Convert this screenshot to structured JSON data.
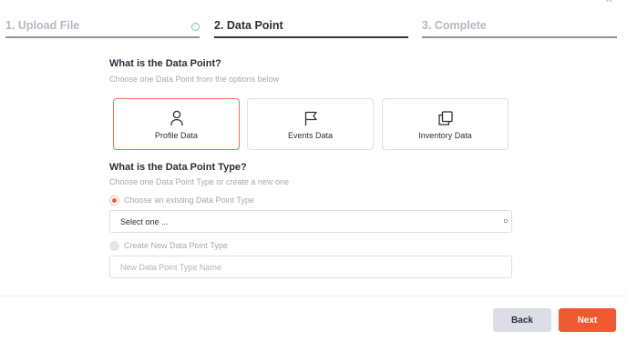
{
  "window": {
    "close_icon": "close-icon"
  },
  "steps": [
    {
      "label": "1. Upload File",
      "status": "done"
    },
    {
      "label": "2. Data Point",
      "status": "active"
    },
    {
      "label": "3. Complete",
      "status": "pending"
    }
  ],
  "data_point": {
    "heading": "What is the Data Point?",
    "subheading": "Choose one Data Point from the options below",
    "options": [
      {
        "label": "Profile Data",
        "icon": "person-icon",
        "selected": true
      },
      {
        "label": "Events Data",
        "icon": "flag-icon",
        "selected": false
      },
      {
        "label": "Inventory Data",
        "icon": "stacked-squares-icon",
        "selected": false
      }
    ]
  },
  "data_point_type": {
    "heading": "What is the Data Point Type?",
    "subheading": "Choose one Data Point Type or create a new one",
    "existing_label": "Choose an existing Data Point Type",
    "select_value": "Select one ...",
    "new_label": "Create New Data Point Type",
    "new_placeholder": "New Data Point Type Name"
  },
  "footer": {
    "back_label": "Back",
    "next_label": "Next"
  },
  "colors": {
    "accent": "#f0582f",
    "selected_border": "#f0744e",
    "done_check": "#7fc59e",
    "back_button": "#dcdde6"
  }
}
